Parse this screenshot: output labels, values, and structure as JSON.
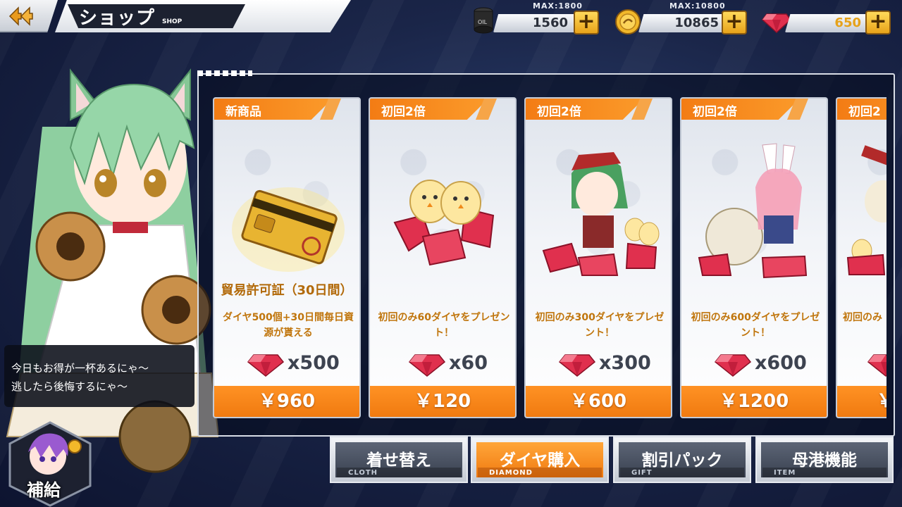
{
  "header": {
    "title": "ショップ",
    "subtitle": "SHOP"
  },
  "resources": [
    {
      "name": "oil",
      "max_label": "MAX:1800",
      "value": "1560"
    },
    {
      "name": "coin",
      "max_label": "MAX:10800",
      "value": "10865"
    },
    {
      "name": "diamond",
      "max_label": "",
      "value": "650"
    }
  ],
  "speech": {
    "line1": "今日もお得が一杯あるにゃ～",
    "line2": "逃したら後悔するにゃ～"
  },
  "supply_button": {
    "label": "補給"
  },
  "products": [
    {
      "tag": "新商品",
      "name": "貿易許可証（30日間）",
      "desc": "ダイヤ500個+30日間毎日資源が貰える",
      "qty": "x500",
      "price": "￥960"
    },
    {
      "tag": "初回2倍",
      "name": "",
      "desc": "初回のみ60ダイヤをプレゼント！",
      "qty": "x60",
      "price": "￥120"
    },
    {
      "tag": "初回2倍",
      "name": "",
      "desc": "初回のみ300ダイヤをプレゼント！",
      "qty": "x300",
      "price": "￥600"
    },
    {
      "tag": "初回2倍",
      "name": "",
      "desc": "初回のみ600ダイヤをプレゼント！",
      "qty": "x600",
      "price": "￥1200"
    },
    {
      "tag": "初回2",
      "name": "",
      "desc": "初回のみ",
      "qty": "",
      "price": "￥"
    }
  ],
  "tabs": [
    {
      "label": "着せ替え",
      "sub": "CLOTH",
      "active": false
    },
    {
      "label": "ダイヤ購入",
      "sub": "DIAMOND",
      "active": true
    },
    {
      "label": "割引パック",
      "sub": "GIFT",
      "active": false
    },
    {
      "label": "母港機能",
      "sub": "ITEM",
      "active": false
    }
  ],
  "colors": {
    "accent_orange": "#f37c14",
    "gem_red": "#e0304e",
    "gold": "#f2b82a",
    "panel_bg": "#0d1430"
  },
  "icons": [
    "back-arrow-icon",
    "oil-barrel-icon",
    "coin-icon",
    "diamond-icon",
    "plus-icon"
  ]
}
